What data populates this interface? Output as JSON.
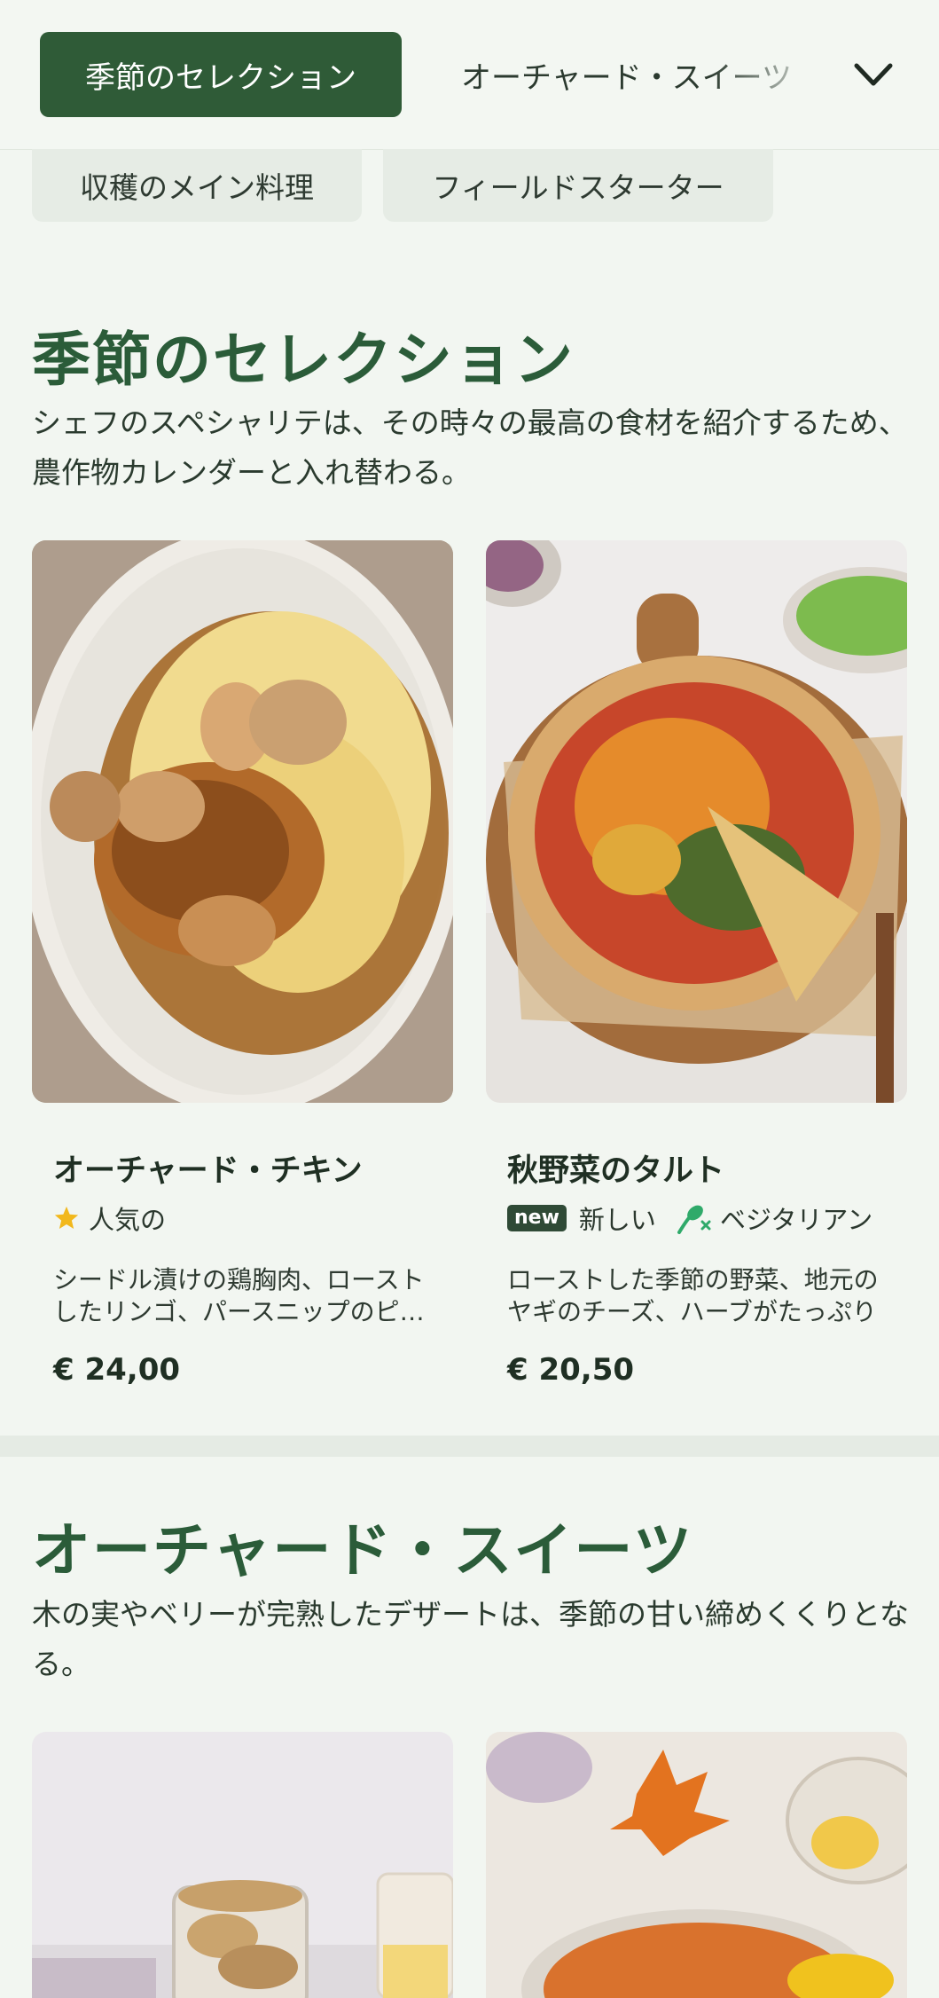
{
  "nav": {
    "active_category": "季節のセレクション",
    "next_category": "オーチャード・スイーツ",
    "chips": [
      "収穫のメイン料理",
      "フィールドスターター"
    ]
  },
  "sections": [
    {
      "title": "季節のセレクション",
      "description": "シェフのスペシャリテは、その時々の最高の食材を紹介するため、農作物カレンダーと入れ替わる。",
      "dishes": [
        {
          "name": "オーチャード・チキン",
          "tags": [
            {
              "icon": "star-icon",
              "label": "人気の"
            }
          ],
          "description": "シードル漬けの鶏胸肉、ローストしたリンゴ、パースニップのピュレ",
          "price": "€ 24,00"
        },
        {
          "name": "秋野菜のタルト",
          "tags": [
            {
              "icon": "new-badge",
              "badge": "new",
              "label": "新しい"
            },
            {
              "icon": "vegetarian-icon",
              "label": "ベジタリアン"
            }
          ],
          "description": "ローストした季節の野菜、地元のヤギのチーズ、ハーブがたっぷり",
          "price": "€ 20,50"
        }
      ]
    },
    {
      "title": "オーチャード・スイーツ",
      "description": "木の実やベリーが完熟したデザートは、季節の甘い締めくくりとなる。"
    }
  ],
  "colors": {
    "accent": "#2f5b37",
    "heading": "#2b5c39",
    "background": "#f2f6f1",
    "star": "#f2b81c",
    "vegetarian": "#2faa6a"
  }
}
